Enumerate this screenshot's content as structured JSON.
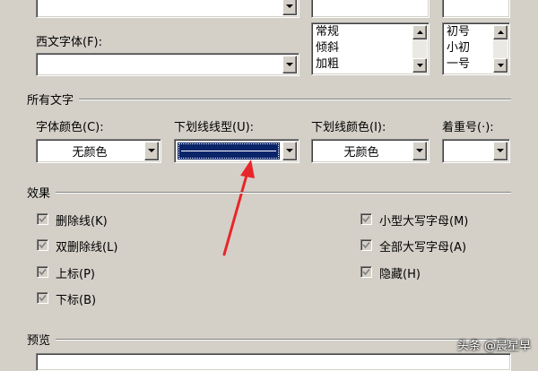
{
  "top_cutoff": {
    "font_style_list": [
      "常规",
      "倾斜",
      "加粗"
    ],
    "font_size_list": [
      "初号",
      "小初",
      "一号"
    ]
  },
  "western_font": {
    "label": "西文字体(F):",
    "value": ""
  },
  "all_text": {
    "title": "所有文字",
    "font_color": {
      "label": "字体颜色(C):",
      "value": "无颜色"
    },
    "underline_style": {
      "label": "下划线线型(U):",
      "value": "——————"
    },
    "underline_color": {
      "label": "下划线颜色(I):",
      "value": "无颜色"
    },
    "emphasis": {
      "label": "着重号(·):",
      "value": ""
    }
  },
  "effects": {
    "title": "效果",
    "left": [
      {
        "label": "删除线(K)",
        "checked": true
      },
      {
        "label": "双删除线(L)",
        "checked": true
      },
      {
        "label": "上标(P)",
        "checked": true
      },
      {
        "label": "下标(B)",
        "checked": true
      }
    ],
    "right": [
      {
        "label": "小型大写字母(M)",
        "checked": true
      },
      {
        "label": "全部大写字母(A)",
        "checked": true
      },
      {
        "label": "隐藏(H)",
        "checked": true
      }
    ]
  },
  "preview": {
    "title": "预览"
  },
  "watermark": "头条 @晨星早",
  "annotation_color": "#e8262a"
}
